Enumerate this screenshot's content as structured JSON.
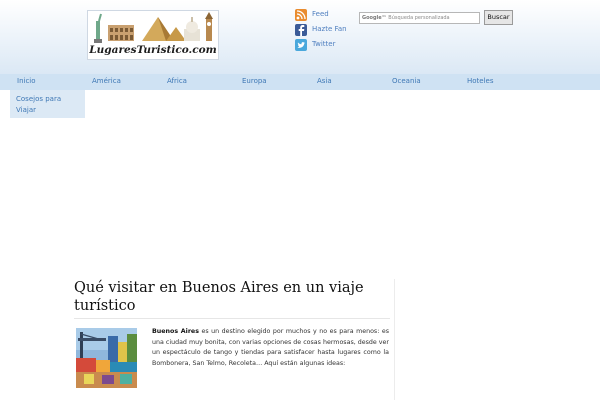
{
  "header": {
    "logo_text": "LugaresTuristico.com",
    "social": [
      {
        "label": "Feed",
        "icon": "rss-icon"
      },
      {
        "label": "Hazte Fan",
        "icon": "facebook-icon"
      },
      {
        "label": "Twitter",
        "icon": "twitter-icon"
      }
    ],
    "search": {
      "brand": "Google™",
      "placeholder": "Búsqueda personalizada",
      "button_label": "Buscar"
    }
  },
  "nav": {
    "items": [
      "Inicio",
      "América",
      "Africa",
      "Europa",
      "Asia",
      "Oceania",
      "Hoteles"
    ],
    "submenu": [
      "Cosejos para Viajar"
    ]
  },
  "article": {
    "title": "Qué visitar en Buenos Aires en un viaje turístico",
    "intro_bold": "Buenos Aires",
    "intro_rest": " es un destino elegido por muchos y no es para menos: es una ciudad muy bonita, con varias opciones de cosas hermosas, desde ver un espectáculo de tango y tiendas para satisfacer hasta lugares como la Bombonera, San Telmo, Recoleta… Aquí están algunas ideas:"
  },
  "colors": {
    "nav_bg": "#cfe2f3",
    "link": "#3f78b5",
    "header_gradient_end": "#dbe8f5"
  }
}
